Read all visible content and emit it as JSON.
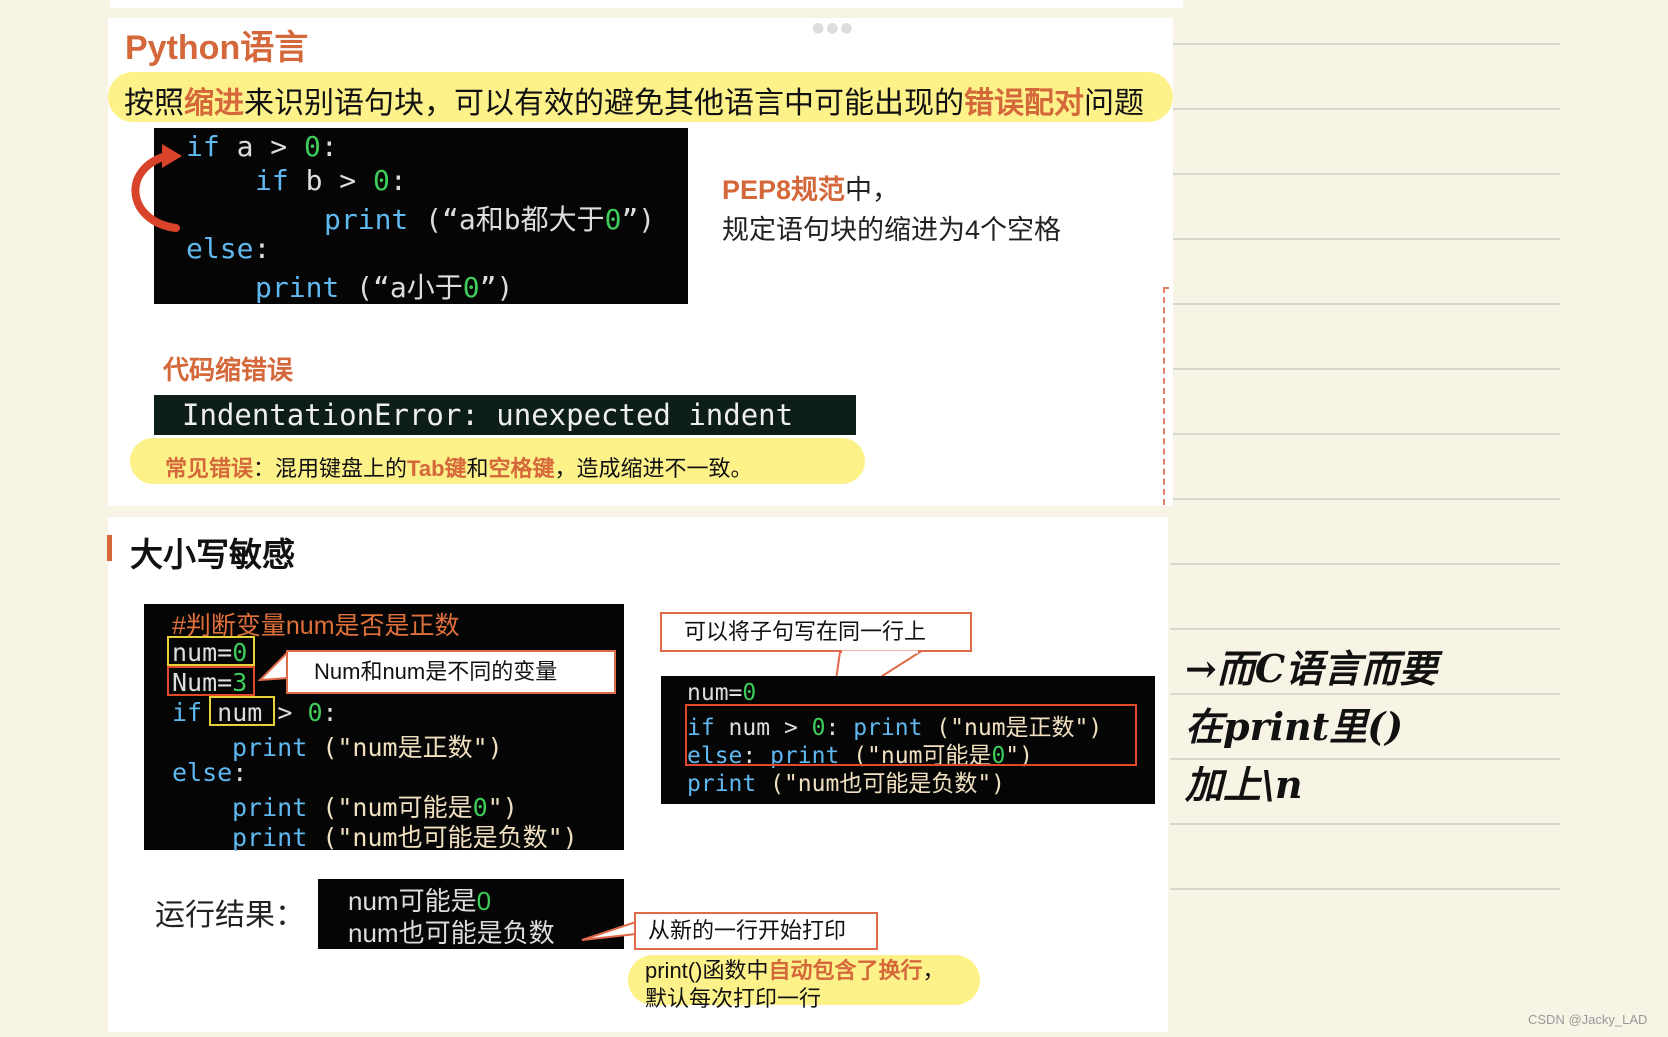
{
  "section1": {
    "title": "Python语言",
    "hl_pre": "按照",
    "hl_k1": "缩进",
    "hl_mid": "来识别语句块，可以有效的避免其他语言中可能出现的",
    "hl_k2": "错误配对",
    "hl_post": "问题",
    "code": {
      "l1_kw": "if",
      "l1_rest": " a > ",
      "l1_num": "0",
      "l1_end": ":",
      "l2_kw": "if",
      "l2_rest": " b > ",
      "l2_num": "0",
      "l2_end": ":",
      "l3_kw": "print",
      "l3_rest": " (“a和b都大于",
      "l3_num": "0",
      "l3_end": "”)",
      "l4_kw": "else",
      "l4_end": ":",
      "l5_kw": "print",
      "l5_rest": " (“a小于",
      "l5_num": "0",
      "l5_end": "”)"
    },
    "pep_k": "PEP8规范",
    "pep_mid": "中，",
    "pep_line2": "规定语句块的缩进为4个空格",
    "err_title": "代码缩错误",
    "err_text": "IndentationError: unexpected indent",
    "common_k": "常见错误",
    "common_1": "：混用键盘上的",
    "common_k2": "Tab键",
    "common_2": "和",
    "common_k3": "空格键",
    "common_3": "，造成缩进不一致。"
  },
  "section2": {
    "title": "大小写敏感",
    "code1": {
      "comment": "#判断变量num是否是正数",
      "l2_name": "num",
      "l2_num": "0",
      "l3_name": "Num",
      "l3_num": "3",
      "l4_kw": "if",
      "l4_var": "num",
      "l4_num": "0",
      "l5_kw": "print",
      "l5_str": "(\"num是正数\")",
      "l6_kw": "else",
      "l7_kw": "print",
      "l7_str_a": "(\"num可能是",
      "l7_num": "0",
      "l7_str_b": "\")",
      "l8_kw": "print",
      "l8_str": "(\"num也可能是负数\")"
    },
    "callout_vars": "Num和num是不同的变量",
    "callout_sameline": "可以将子句写在同一行上",
    "code2": {
      "l1": "num=",
      "l1_num": "0",
      "l2_kw": "if",
      "l2_rest": " num > ",
      "l2_num": "0",
      "l2_p": ": ",
      "l2_kw2": "print",
      "l2_str": " (\"num是正数\")",
      "l3_kw": "else",
      "l3_p": ": ",
      "l3_kw2": "print",
      "l3_str_a": " (\"num可能是",
      "l3_num": "0",
      "l3_str_b": "\")",
      "l4_kw": "print",
      "l4_str": " (\"num也可能是负数\")"
    },
    "result_label": "运行结果：",
    "result_l1_a": "num可能是",
    "result_l1_num": "0",
    "result_l2": "num也可能是负数",
    "callout_newline": "从新的一行开始打印",
    "print_a": "print()函数中",
    "print_k": "自动包含了换行",
    "print_b": "，",
    "print_line2": "默认每次打印一行"
  },
  "handwriting": {
    "l1": "→而C语言而要",
    "l2": "在print里()",
    "l3": "加上\\n"
  },
  "credit": "CSDN @Jacky_LAD"
}
